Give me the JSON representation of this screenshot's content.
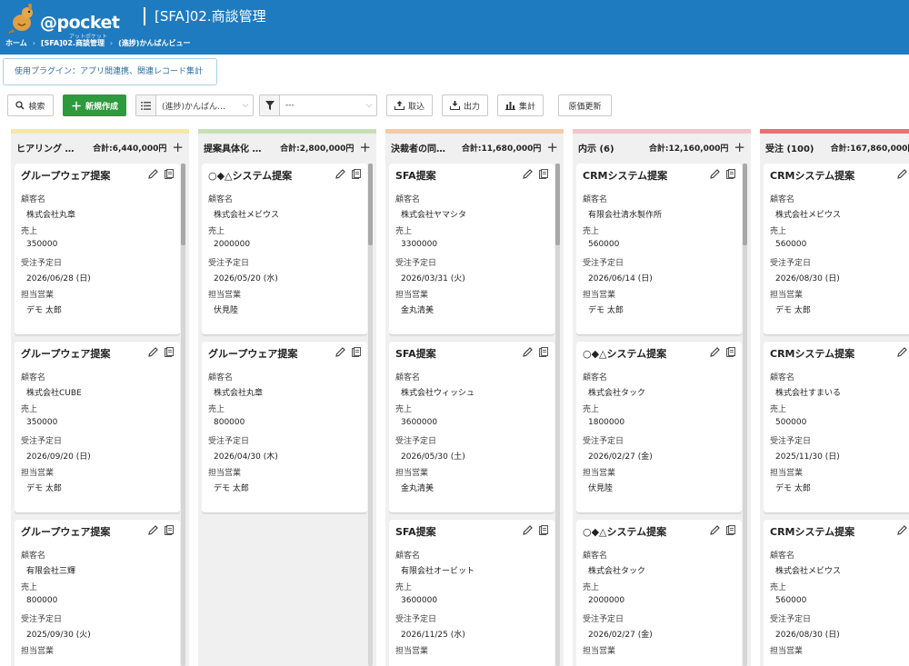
{
  "header": {
    "logo_text": "@pocket",
    "logo_sub": "アットポケット",
    "title": "[SFA]02.商談管理",
    "breadcrumb": [
      "ホーム",
      "[SFA]02.商談管理",
      "(進捗)かんばんビュー"
    ]
  },
  "plugin_info": "使用プラグイン：アプリ間連携、関連レコード集計",
  "toolbar": {
    "search_label": "検索",
    "new_label": "新規作成",
    "view_select": "(進捗)かんばん…",
    "filter_select": "---",
    "import_label": "取込",
    "export_label": "出力",
    "aggregate_label": "集計",
    "cost_update_label": "原価更新"
  },
  "field_labels": {
    "customer": "顧客名",
    "sales": "売上",
    "order_date": "受注予定日",
    "rep": "担当営業"
  },
  "columns": [
    {
      "name": "ヒアリング …",
      "total": "合計:6,440,000円",
      "color": "#f5e7a8",
      "cards": [
        {
          "title": "グループウェア提案",
          "customer": "株式会社丸章",
          "sales": "350000",
          "date": "2026/06/28 (日)",
          "rep": "デモ 太郎"
        },
        {
          "title": "グループウェア提案",
          "customer": "株式会社CUBE",
          "sales": "350000",
          "date": "2026/09/20 (日)",
          "rep": "デモ 太郎"
        },
        {
          "title": "グループウェア提案",
          "customer": "有限会社三輝",
          "sales": "800000",
          "date": "2025/09/30 (火)",
          "rep": ""
        }
      ]
    },
    {
      "name": "提案具体化 …",
      "total": "合計:2,800,000円",
      "color": "#c6e0b4",
      "cards": [
        {
          "title": "○◆△システム提案",
          "customer": "株式会社メビウス",
          "sales": "2000000",
          "date": "2026/05/20 (水)",
          "rep": "伏見陸"
        },
        {
          "title": "グループウェア提案",
          "customer": "株式会社丸章",
          "sales": "800000",
          "date": "2026/04/30 (木)",
          "rep": "デモ 太郎"
        }
      ]
    },
    {
      "name": "決裁者の同…",
      "total": "合計:11,680,000円",
      "color": "#f6c9a8",
      "cards": [
        {
          "title": "SFA提案",
          "customer": "株式会社ヤマシタ",
          "sales": "3300000",
          "date": "2026/03/31 (火)",
          "rep": "金丸清美"
        },
        {
          "title": "SFA提案",
          "customer": "株式会社ウィッシュ",
          "sales": "3600000",
          "date": "2026/05/30 (土)",
          "rep": "金丸清美"
        },
        {
          "title": "SFA提案",
          "customer": "有限会社オービット",
          "sales": "3600000",
          "date": "2026/11/25 (水)",
          "rep": ""
        }
      ]
    },
    {
      "name": "内示 (6)",
      "total": "合計:12,160,000円",
      "color": "#f2c4cc",
      "cards": [
        {
          "title": "CRMシステム提案",
          "customer": "有限会社清水製作所",
          "sales": "560000",
          "date": "2026/06/14 (日)",
          "rep": "デモ 太郎"
        },
        {
          "title": "○◆△システム提案",
          "customer": "株式会社タック",
          "sales": "1800000",
          "date": "2026/02/27 (金)",
          "rep": "伏見陸"
        },
        {
          "title": "○◆△システム提案",
          "customer": "株式会社タック",
          "sales": "2000000",
          "date": "2026/02/27 (金)",
          "rep": ""
        }
      ]
    },
    {
      "name": "受注 (100)",
      "total": "合計:167,860,000円",
      "color": "#e57373",
      "cards": [
        {
          "title": "CRMシステム提案",
          "customer": "株式会社メビウス",
          "sales": "560000",
          "date": "2026/08/30 (日)",
          "rep": "デモ 太郎"
        },
        {
          "title": "CRMシステム提案",
          "customer": "株式会社すまいる",
          "sales": "500000",
          "date": "2025/11/30 (日)",
          "rep": "デモ 太郎"
        },
        {
          "title": "CRMシステム提案",
          "customer": "株式会社メビウス",
          "sales": "560000",
          "date": "2026/08/30 (日)",
          "rep": ""
        }
      ]
    }
  ]
}
